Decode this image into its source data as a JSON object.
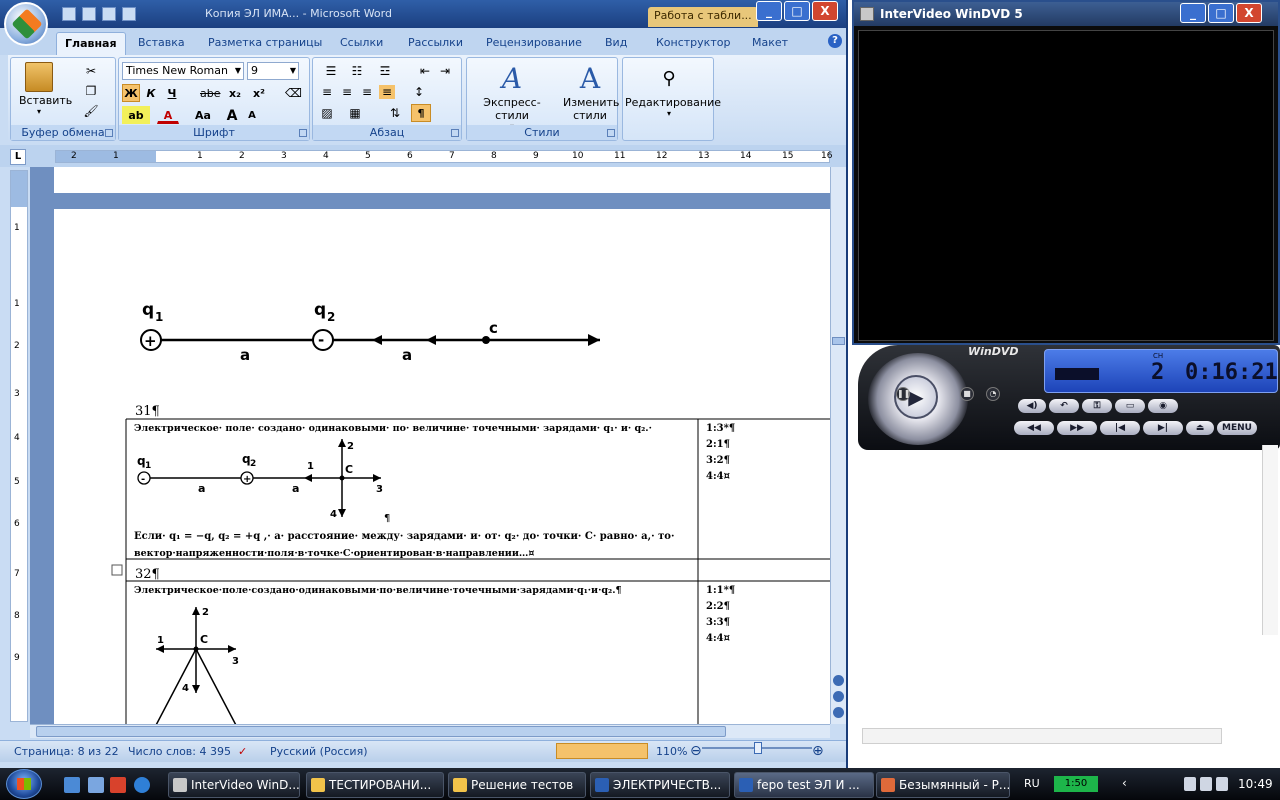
{
  "word": {
    "title": "Копия ЭЛ ИМА... - Microsoft Word",
    "context_tab": "Работа с табли...",
    "tabs": [
      "Главная",
      "Вставка",
      "Разметка страницы",
      "Ссылки",
      "Рассылки",
      "Рецензирование",
      "Вид",
      "Конструктор",
      "Макет"
    ],
    "active_tab": "Главная",
    "clipboard": {
      "paste": "Вставить",
      "label": "Буфер обмена"
    },
    "font": {
      "name": "Times New Roman",
      "size": "9",
      "label": "Шрифт",
      "bold": "Ж",
      "italic": "К",
      "underline": "Ч",
      "strike": "abe",
      "sub": "x₂",
      "sup": "x²",
      "grow": "A",
      "shrink": "A",
      "case": "Aa"
    },
    "paragraph": {
      "label": "Абзац",
      "pilcrow": "¶"
    },
    "styles": {
      "express": "Экспресс-стили",
      "change_line1": "Изменить",
      "change_line2": "стили",
      "label": "Стили"
    },
    "editing": {
      "label": "Редактирование"
    },
    "ruler_ticks": [
      "2",
      "1",
      "1",
      "2",
      "3",
      "4",
      "5",
      "6",
      "7",
      "8",
      "9",
      "10",
      "11",
      "12",
      "13",
      "14",
      "15",
      "16"
    ],
    "vruler_ticks": [
      "1",
      "1",
      "2",
      "3",
      "4",
      "5",
      "6",
      "7",
      "8",
      "9"
    ],
    "status": {
      "page": "Страница: 8 из 22",
      "words": "Число слов: 4 395",
      "lang": "Русский (Россия)",
      "zoom": "110%"
    }
  },
  "document": {
    "fig1": {
      "q1": "q",
      "q1_sub": "1",
      "q2": "q",
      "q2_sub": "2",
      "q1_sign": "+",
      "q2_sign": "-",
      "a1": "a",
      "a2": "a",
      "c": "c"
    },
    "q31": {
      "num": "31¶",
      "text": "Электрическое· поле· создано· одинаковыми· по· величине· точечными· зарядами· q₁· и· q₂.·",
      "fig": {
        "q1": "q",
        "q1_sub": "1",
        "q2": "q",
        "q2_sub": "2",
        "q1_sign": "-",
        "q2_sign": "+",
        "a1": "a",
        "a2": "a",
        "c": "C",
        "d1": "1",
        "d2": "2",
        "d3": "3",
        "d4": "4",
        "pil": "¶"
      },
      "cond_line1": "Если· q₁ = −q, q₂ = +q ,· a· расстояние· между· зарядами· и· от· q₂· до· точки· С· равно· a,· то·",
      "cond_line2": "вектор·напряженности·поля·в·точке·С·ориентирован·в·направлении…¤",
      "answers": [
        "1:3*¶",
        "2:1¶",
        "3:2¶",
        "4:4¤"
      ]
    },
    "q32": {
      "num": "32¶",
      "text": "Электрическое·поле·создано·одинаковыми·по·величине·точечными·зарядами·q₁·и·q₂.¶",
      "fig": {
        "c": "C",
        "d1": "1",
        "d2": "2",
        "d3": "3",
        "d4": "4"
      },
      "answers": [
        "1:1*¶",
        "2:2¶",
        "3:3¶",
        "4:4¤"
      ]
    }
  },
  "dvd": {
    "title": "InterVideo WinDVD 5",
    "logo": "WinDVD",
    "chapter_label": "CH",
    "chapter": "2",
    "time": "0:16:21",
    "buttons": [
      "◀◀",
      "▶▶",
      "|◀",
      "▶|",
      "⏏",
      "MENU"
    ]
  },
  "taskbar": {
    "tasks": [
      "InterVideo WinD...",
      "ТЕСТИРОВАНИ...",
      "Решение тестов",
      "ЭЛЕКТРИЧЕСТВ...",
      "fepo test ЭЛ И ...",
      "Безымянный - Р..."
    ],
    "lang": "RU",
    "vol": "1:50",
    "clock": "10:49"
  }
}
